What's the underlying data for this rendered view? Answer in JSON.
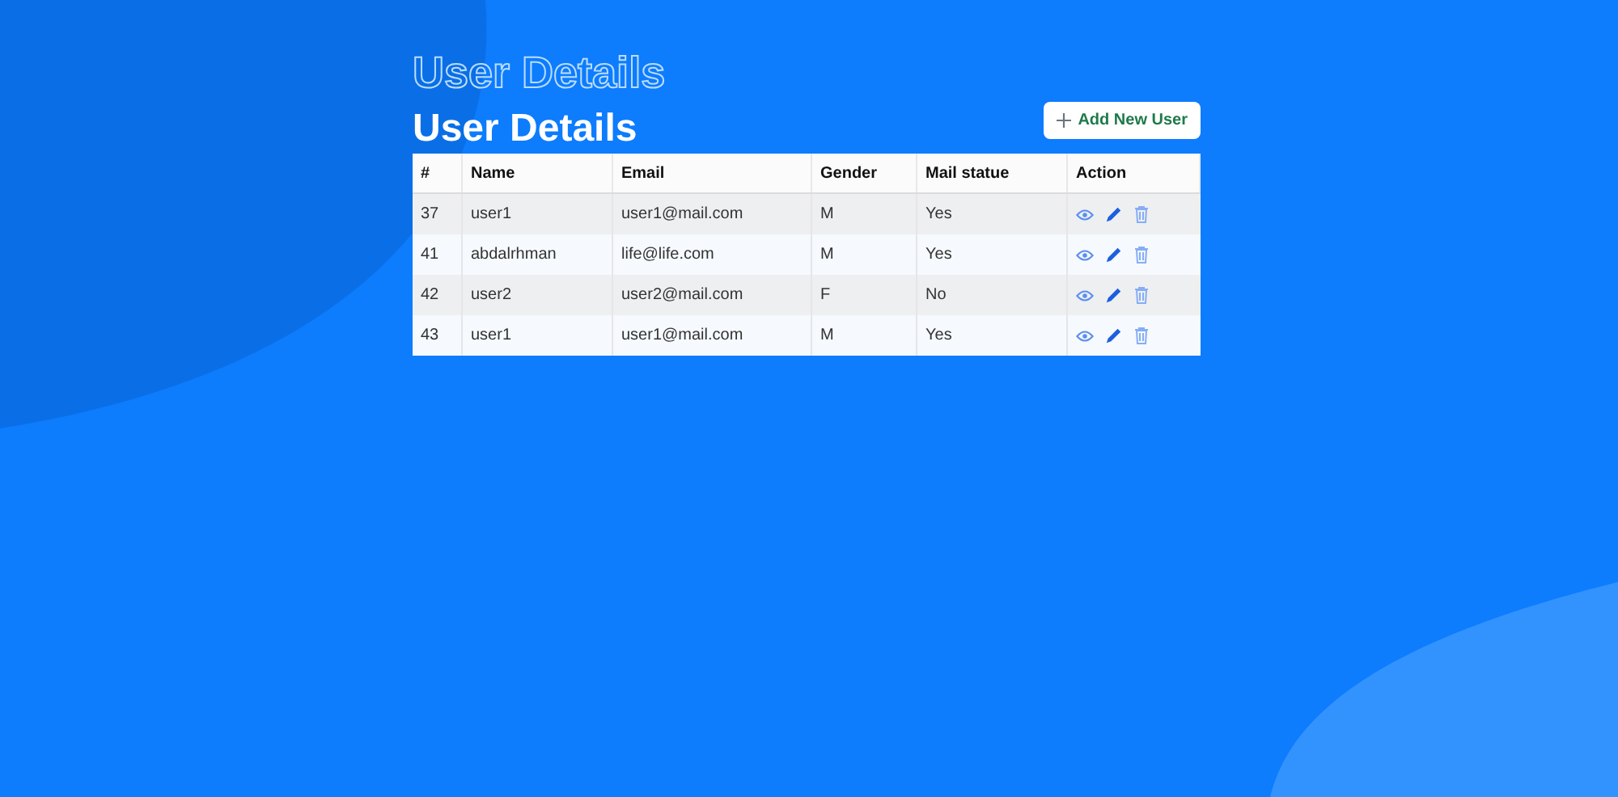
{
  "outline_title": "User Details",
  "title": "User Details",
  "add_button": {
    "label": "Add New User"
  },
  "table": {
    "columns": [
      "#",
      "Name",
      "Email",
      "Gender",
      "Mail statue",
      "Action"
    ],
    "rows": [
      {
        "id": "37",
        "name": "user1",
        "email": "user1@mail.com",
        "gender": "M",
        "mail_status": "Yes"
      },
      {
        "id": "41",
        "name": "abdalrhman",
        "email": "life@life.com",
        "gender": "M",
        "mail_status": "Yes"
      },
      {
        "id": "42",
        "name": "user2",
        "email": "user2@mail.com",
        "gender": "F",
        "mail_status": "No"
      },
      {
        "id": "43",
        "name": "user1",
        "email": "user1@mail.com",
        "gender": "M",
        "mail_status": "Yes"
      }
    ]
  }
}
